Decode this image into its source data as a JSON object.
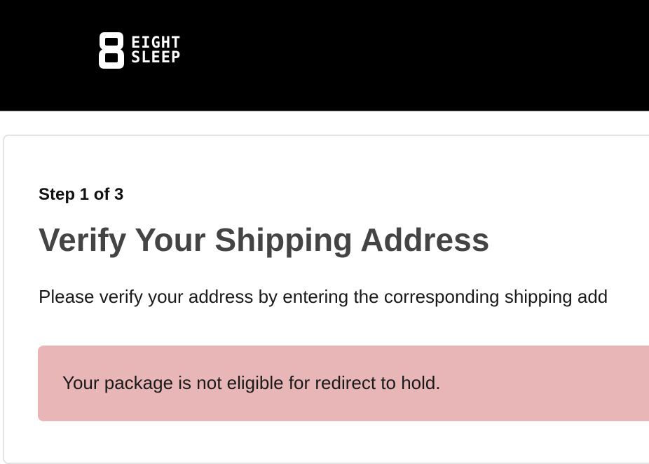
{
  "header": {
    "logo": {
      "mark": "8",
      "line1": "EIGHT",
      "line2": "SLEEP"
    },
    "background_color": "#000000"
  },
  "verification": {
    "step_label": "Step 1 of 3",
    "title": "Verify Your Shipping Address",
    "description": "Please verify your address by entering the corresponding shipping add"
  },
  "alert": {
    "message": "Your package is not eligible for redirect to hold.",
    "background_color": "#e8b6b6"
  }
}
